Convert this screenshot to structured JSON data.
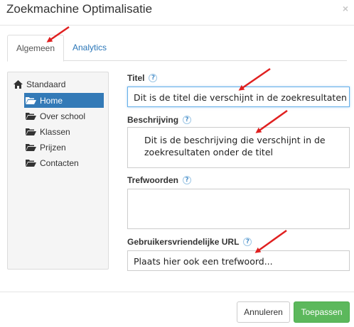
{
  "dialog": {
    "title": "Zoekmachine Optimalisatie",
    "close_glyph": "×"
  },
  "tabs": [
    {
      "label": "Algemeen",
      "active": true
    },
    {
      "label": "Analytics",
      "active": false
    }
  ],
  "tree": {
    "root_label": "Standaard",
    "items": [
      {
        "label": "Home",
        "selected": true
      },
      {
        "label": "Over school",
        "selected": false
      },
      {
        "label": "Klassen",
        "selected": false
      },
      {
        "label": "Prijzen",
        "selected": false
      },
      {
        "label": "Contacten",
        "selected": false
      }
    ]
  },
  "form": {
    "title_label": "Titel",
    "title_value": "Dit is de titel die verschijnt in de zoekresultaten",
    "description_label": "Beschrijving",
    "description_value": "Dit is de beschrijving die verschijnt in de zoekresultaten onder de titel",
    "keywords_label": "Trefwoorden",
    "keywords_value": "",
    "url_label": "Gebruikersvriendelijke URL",
    "url_value": "Plaats hier ook een trefwoord...",
    "help_glyph": "?"
  },
  "buttons": {
    "cancel": "Annuleren",
    "apply": "Toepassen"
  },
  "colors": {
    "accent": "#337ab7",
    "link": "#2a76b8",
    "apply": "#5cb85c",
    "annotation_arrow": "#e02020"
  },
  "icons": {
    "home": "home-icon",
    "folder": "folder-open-icon",
    "help": "help-icon",
    "close": "close-icon"
  }
}
